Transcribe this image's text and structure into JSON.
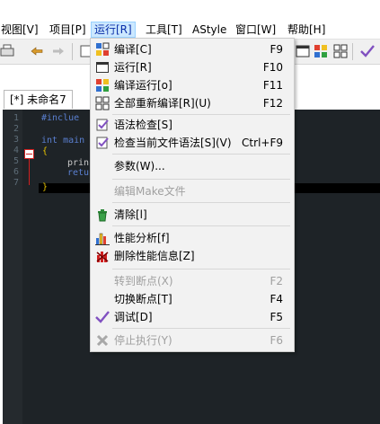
{
  "menubar": {
    "items": [
      {
        "label": "视图[V]"
      },
      {
        "label": "项目[P]"
      },
      {
        "label": "运行[R]"
      },
      {
        "label": "工具[T]"
      },
      {
        "label": "AStyle"
      },
      {
        "label": "窗口[W]"
      },
      {
        "label": "帮助[H]"
      }
    ]
  },
  "tabs": [
    {
      "label": "[*] 未命名7"
    }
  ],
  "editor": {
    "line_numbers": [
      "1",
      "2",
      "3",
      "4",
      "5",
      "6",
      "7"
    ],
    "code": {
      "line1": "#inclue",
      "line3": "int main",
      "line4": "{",
      "line5": "prin",
      "line6": "retu",
      "line7": "}"
    }
  },
  "run_menu": {
    "items": [
      {
        "label": "编译[C]",
        "shortcut": "F9",
        "icon": "compile-grid-icon"
      },
      {
        "label": "运行[R]",
        "shortcut": "F10",
        "icon": "run-window-icon"
      },
      {
        "label": "编译运行[o]",
        "shortcut": "F11",
        "icon": "compile-run-icon"
      },
      {
        "label": "全部重新编译[R](U)",
        "shortcut": "F12",
        "icon": "rebuild-all-icon"
      },
      {
        "label": "语法检查[S]",
        "shortcut": "",
        "icon": "syntax-check-icon"
      },
      {
        "label": "检查当前文件语法[S](V)",
        "shortcut": "Ctrl+F9",
        "icon": "syntax-check-file-icon"
      },
      {
        "label": "参数(W)...",
        "shortcut": ""
      },
      {
        "label": "编辑Make文件",
        "shortcut": ""
      },
      {
        "label": "清除[l]",
        "shortcut": "",
        "icon": "clean-icon"
      },
      {
        "label": "性能分析[f]",
        "shortcut": "",
        "icon": "profile-chart-icon"
      },
      {
        "label": "删除性能信息[Z]",
        "shortcut": "",
        "icon": "delete-profile-icon"
      },
      {
        "label": "转到断点(X)",
        "shortcut": "F2"
      },
      {
        "label": "切换断点[T]",
        "shortcut": "F4"
      },
      {
        "label": "调试[D]",
        "shortcut": "F5",
        "icon": "debug-check-icon"
      },
      {
        "label": "停止执行(Y)",
        "shortcut": "F6",
        "icon": "stop-x-icon"
      }
    ]
  },
  "colors": {
    "editor_bg": "#1e2327",
    "menu_bg": "#f2f2f2",
    "menubar_active": "#cce8ff",
    "keyword": "#5a7fd0",
    "disabled_text": "#a0a0a0"
  }
}
